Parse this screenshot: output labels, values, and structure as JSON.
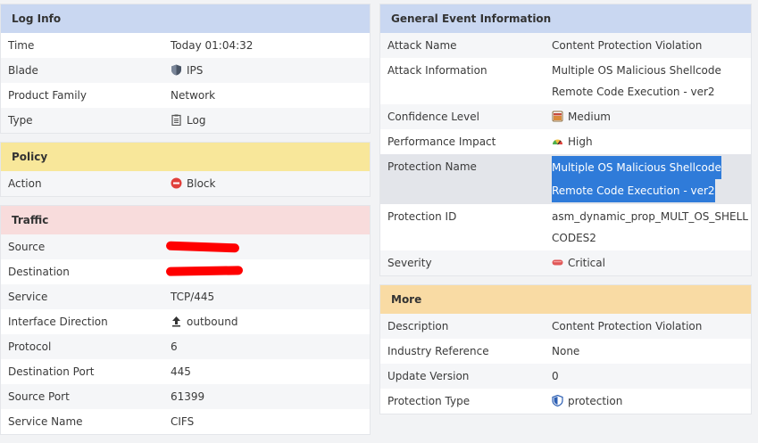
{
  "log_info": {
    "title": "Log Info",
    "rows": [
      {
        "label": "Time",
        "value": "Today 01:04:32",
        "icon": ""
      },
      {
        "label": "Blade",
        "value": "IPS",
        "icon": "shield-icon"
      },
      {
        "label": "Product Family",
        "value": "Network",
        "icon": ""
      },
      {
        "label": "Type",
        "value": "Log",
        "icon": "log-icon"
      }
    ]
  },
  "policy": {
    "title": "Policy",
    "rows": [
      {
        "label": "Action",
        "value": "Block",
        "icon": "block-icon"
      }
    ]
  },
  "traffic": {
    "title": "Traffic",
    "rows": [
      {
        "label": "Source",
        "value": "",
        "icon": ""
      },
      {
        "label": "Destination",
        "value": "",
        "icon": ""
      },
      {
        "label": "Service",
        "value": "TCP/445",
        "icon": ""
      },
      {
        "label": "Interface Direction",
        "value": "outbound",
        "icon": "arrow-up-icon"
      },
      {
        "label": "Protocol",
        "value": "6",
        "icon": ""
      },
      {
        "label": "Destination Port",
        "value": "445",
        "icon": ""
      },
      {
        "label": "Source Port",
        "value": "61399",
        "icon": ""
      },
      {
        "label": "Service Name",
        "value": "CIFS",
        "icon": ""
      }
    ]
  },
  "general_event": {
    "title": "General Event Information",
    "rows": [
      {
        "label": "Attack Name",
        "value": "Content Protection Violation"
      },
      {
        "label": "Attack Information",
        "value": "Multiple OS Malicious Shellcode",
        "value2": "Remote Code Execution - ver2"
      },
      {
        "label": "Confidence Level",
        "value": "Medium"
      },
      {
        "label": "Performance Impact",
        "value": "High"
      },
      {
        "label": "Protection Name",
        "value": "Multiple OS Malicious Shellcode",
        "value2": "Remote Code Execution - ver2"
      },
      {
        "label": "Protection ID",
        "value": "asm_dynamic_prop_MULT_OS_SHELL",
        "value2": "CODES2"
      },
      {
        "label": "Severity",
        "value": "Critical"
      }
    ]
  },
  "more": {
    "title": "More",
    "rows": [
      {
        "label": "Description",
        "value": "Content Protection Violation"
      },
      {
        "label": "Industry Reference",
        "value": "None"
      },
      {
        "label": "Update Version",
        "value": "0"
      },
      {
        "label": "Protection Type",
        "value": "protection"
      }
    ]
  },
  "colors": {
    "header_blue": "#c9d7f1",
    "header_yellow": "#f8e79a",
    "header_pink": "#f8dcdc",
    "header_orange": "#f9dba4",
    "selection": "#2f7bd9",
    "redaction": "#ff0000"
  }
}
